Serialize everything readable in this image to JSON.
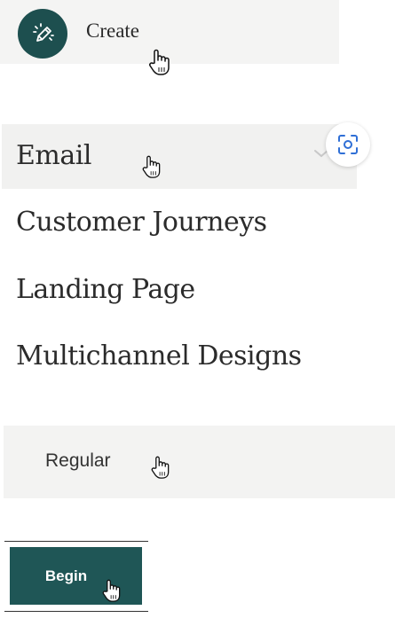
{
  "create": {
    "label": "Create",
    "icon": "pencil-sparkle-icon"
  },
  "menu": {
    "items": [
      {
        "label": "Email"
      },
      {
        "label": "Customer Journeys"
      },
      {
        "label": "Landing Page"
      },
      {
        "label": "Multichannel Designs"
      }
    ]
  },
  "regular": {
    "label": "Regular"
  },
  "begin": {
    "label": "Begin"
  },
  "colors": {
    "brand": "#1d4f4f",
    "focus_accent": "#2f6fd6"
  }
}
